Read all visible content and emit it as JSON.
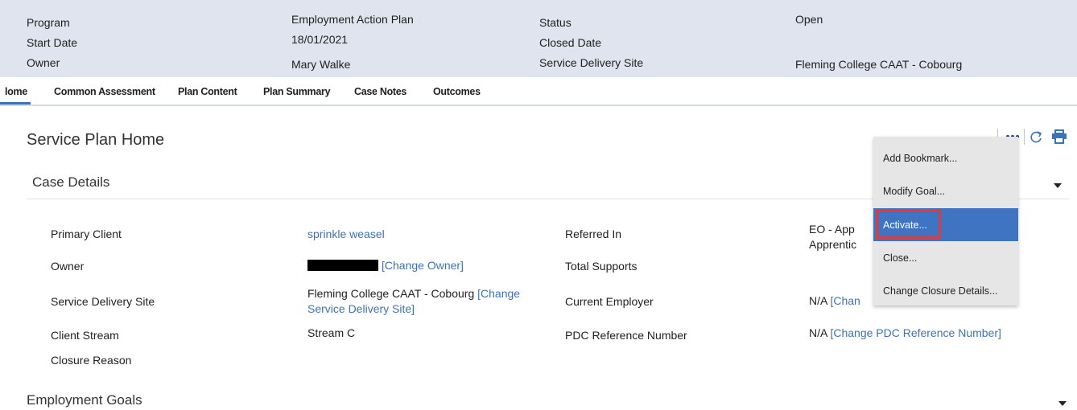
{
  "summary": {
    "program_label": "Program",
    "program_value": "Employment Action Plan",
    "start_date_label": "Start Date",
    "start_date_value": "18/01/2021",
    "owner_label": "Owner",
    "owner_value": "Mary Walke",
    "status_label": "Status",
    "status_value": "Open",
    "closed_date_label": "Closed Date",
    "closed_date_value": "",
    "site_label": "Service Delivery Site",
    "site_value": "Fleming College CAAT - Cobourg"
  },
  "tabs": [
    {
      "label": "lome"
    },
    {
      "label": "Common Assessment"
    },
    {
      "label": "Plan Content"
    },
    {
      "label": "Plan Summary"
    },
    {
      "label": "Case Notes"
    },
    {
      "label": "Outcomes"
    }
  ],
  "page_title": "Service Plan Home",
  "case_details": {
    "title": "Case Details",
    "primary_client_label": "Primary Client",
    "primary_client_value": "sprinkle weasel",
    "owner_label": "Owner",
    "owner_change": "[Change Owner]",
    "site_label": "Service Delivery Site",
    "site_value": "Fleming College CAAT - Cobourg",
    "site_change": "[Change Service Delivery Site]",
    "client_stream_label": "Client Stream",
    "client_stream_value": "Stream C",
    "closure_reason_label": "Closure Reason",
    "referred_in_label": "Referred In",
    "referred_in_value_line1": "EO - App",
    "referred_in_value_line2": "Apprentic",
    "total_supports_label": "Total Supports",
    "current_employer_label": "Current Employer",
    "current_employer_value": "N/A",
    "current_employer_change": "[Chan",
    "pdc_label": "PDC Reference Number",
    "pdc_value": "N/A",
    "pdc_change": "[Change PDC Reference Number]"
  },
  "employment_goals": {
    "title": "Employment Goals"
  },
  "menu": {
    "items": [
      {
        "label": "Add Bookmark..."
      },
      {
        "label": "Modify Goal..."
      },
      {
        "label": "Activate..."
      },
      {
        "label": "Close..."
      },
      {
        "label": "Change Closure Details..."
      }
    ]
  },
  "icons": {
    "more": "more-icon",
    "refresh": "refresh-icon",
    "print": "print-icon"
  },
  "colors": {
    "accent": "#3c73b8",
    "summary_bg": "#dfe4ee",
    "menu_active": "#3f74c2",
    "highlight": "#e0393e"
  }
}
